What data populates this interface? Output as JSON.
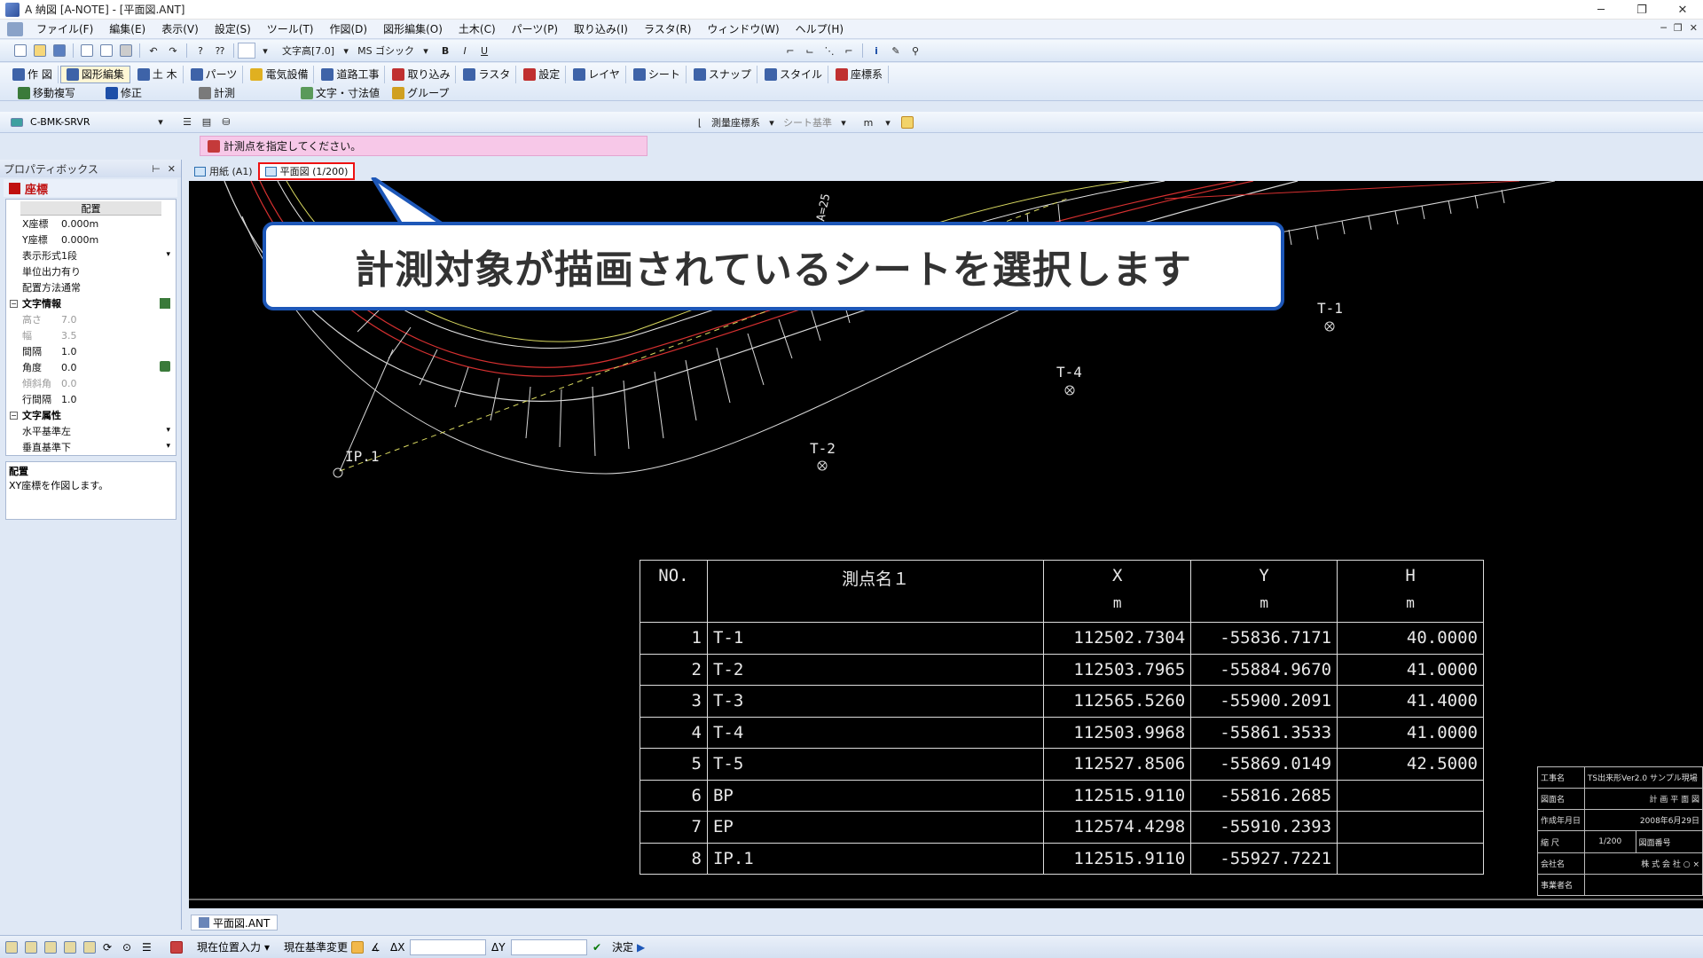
{
  "window": {
    "title": "A 納図 [A-NOTE] - [平面図.ANT]",
    "controls": [
      "─",
      "❐",
      "✕"
    ]
  },
  "menu": [
    "ファイル(F)",
    "編集(E)",
    "表示(V)",
    "設定(S)",
    "ツール(T)",
    "作図(D)",
    "図形編集(O)",
    "土木(C)",
    "パーツ(P)",
    "取り込み(I)",
    "ラスタ(R)",
    "ウィンドウ(W)",
    "ヘルプ(H)"
  ],
  "mdi_controls": [
    "─",
    "❐",
    "✕"
  ],
  "toolbar": {
    "text_height": "文字高[7.0]",
    "font": "MS ゴシック",
    "bold": "B",
    "italic": "I",
    "underline": "U"
  },
  "mode_tabs": [
    "作 図",
    "図形編集",
    "土 木",
    "パーツ",
    "電気設備",
    "道路工事",
    "取り込み",
    "ラスタ",
    "設定",
    "レイヤ",
    "シート",
    "スナップ",
    "スタイル",
    "座標系"
  ],
  "sub_tools": [
    "移動複写",
    "修正",
    "計測",
    "文字・寸法値",
    "グループ"
  ],
  "layer_combo": "C-BMK-SRVR",
  "coord_system": {
    "label": "測量座標系",
    "sheet_ref": "シート基準",
    "unit": "m"
  },
  "prompt": "計測点を指定してください。",
  "property_box": {
    "title": "プロパティボックス",
    "selected": "座標",
    "column_header": "配置",
    "rows": [
      {
        "k": "X座標",
        "v": "0.000m"
      },
      {
        "k": "Y座標",
        "v": "0.000m"
      },
      {
        "k": "表示形式",
        "v": "1段"
      },
      {
        "k": "単位出力",
        "v": "有り"
      },
      {
        "k": "配置方法",
        "v": "通常"
      }
    ],
    "section_text": "文字情報",
    "text_rows": [
      {
        "k": "高さ",
        "v": "7.0"
      },
      {
        "k": "幅",
        "v": "3.5"
      },
      {
        "k": "間隔",
        "v": "1.0"
      },
      {
        "k": "角度",
        "v": "0.0"
      },
      {
        "k": "傾斜角",
        "v": "0.0"
      },
      {
        "k": "行間隔",
        "v": "1.0"
      }
    ],
    "section_attr": "文字属性",
    "attr_rows": [
      {
        "k": "水平基準",
        "v": "左"
      },
      {
        "k": "垂直基準",
        "v": "下"
      }
    ],
    "desc_title": "配置",
    "desc_text": "XY座標を作図します。"
  },
  "sheet_tabs": [
    "用紙 (A1)",
    "平面図 (1/200)"
  ],
  "callout": "計測対象が描画されているシートを選択します",
  "drawing_labels": [
    "T-1",
    "T-4",
    "T-2",
    "IP.1",
    "A=25"
  ],
  "table": {
    "headers": [
      "NO.",
      "測点名１",
      "X",
      "Y",
      "H"
    ],
    "units": [
      "",
      "",
      "m",
      "m",
      "m"
    ],
    "rows": [
      [
        "1",
        "T-1",
        "112502.7304",
        "-55836.7171",
        "40.0000"
      ],
      [
        "2",
        "T-2",
        "112503.7965",
        "-55884.9670",
        "41.0000"
      ],
      [
        "3",
        "T-3",
        "112565.5260",
        "-55900.2091",
        "41.4000"
      ],
      [
        "4",
        "T-4",
        "112503.9968",
        "-55861.3533",
        "41.0000"
      ],
      [
        "5",
        "T-5",
        "112527.8506",
        "-55869.0149",
        "42.5000"
      ],
      [
        "6",
        "BP",
        "112515.9110",
        "-55816.2685",
        ""
      ],
      [
        "7",
        "EP",
        "112574.4298",
        "-55910.2393",
        ""
      ],
      [
        "8",
        "IP.1",
        "112515.9110",
        "-55927.7221",
        ""
      ]
    ]
  },
  "title_block": [
    [
      "工事名",
      "TS出来形Ver2.0 サンプル現場"
    ],
    [
      "図面名",
      "計 画 平 面 図"
    ],
    [
      "作成年月日",
      "2008年6月29日"
    ],
    [
      "縮 尺",
      "1/200",
      "図面番号"
    ],
    [
      "会社名",
      "株 式 会 社 ○ ×"
    ],
    [
      "事業者名",
      ""
    ]
  ],
  "doc_tab": "平面図.ANT",
  "status": {
    "input_mode": "現在位置入力",
    "base_change": "現在基準変更",
    "dx": "ΔX",
    "dy": "ΔY",
    "confirm": "決定"
  },
  "colors": {
    "callout_border": "#1d57b8",
    "prompt_bg": "#f7c8e8",
    "selected_tab_border": "#ee1111"
  }
}
